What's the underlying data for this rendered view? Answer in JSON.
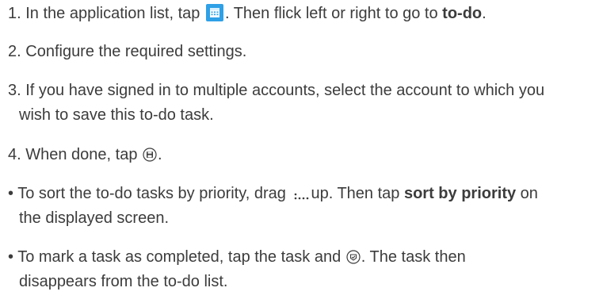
{
  "steps": [
    {
      "num": "1.",
      "pre": "In the application list, tap",
      "icon": "calendar-app-icon",
      "mid": ". Then flick left or right to go to",
      "bold": "to-do",
      "post": "."
    },
    {
      "num": "2.",
      "text": "Configure the required settings."
    },
    {
      "num": "3.",
      "line1": "If you have signed in to multiple accounts, select the account to which you",
      "line2": "wish to save this to-do task."
    },
    {
      "num": "4.",
      "pre": "When done, tap",
      "icon": "save-icon",
      "post": "."
    }
  ],
  "bullets": [
    {
      "marker": "•",
      "pre": "To sort the to-do tasks by priority, drag",
      "icon": "drag-handle-icon",
      "mid": "up. Then tap",
      "bold": "sort by priority",
      "post": "on",
      "line2": "the displayed screen."
    },
    {
      "marker": "•",
      "pre": "To mark a task as completed, tap the task and",
      "icon": "complete-icon",
      "post": ". The task then",
      "line2": "disappears from the to-do list."
    }
  ]
}
